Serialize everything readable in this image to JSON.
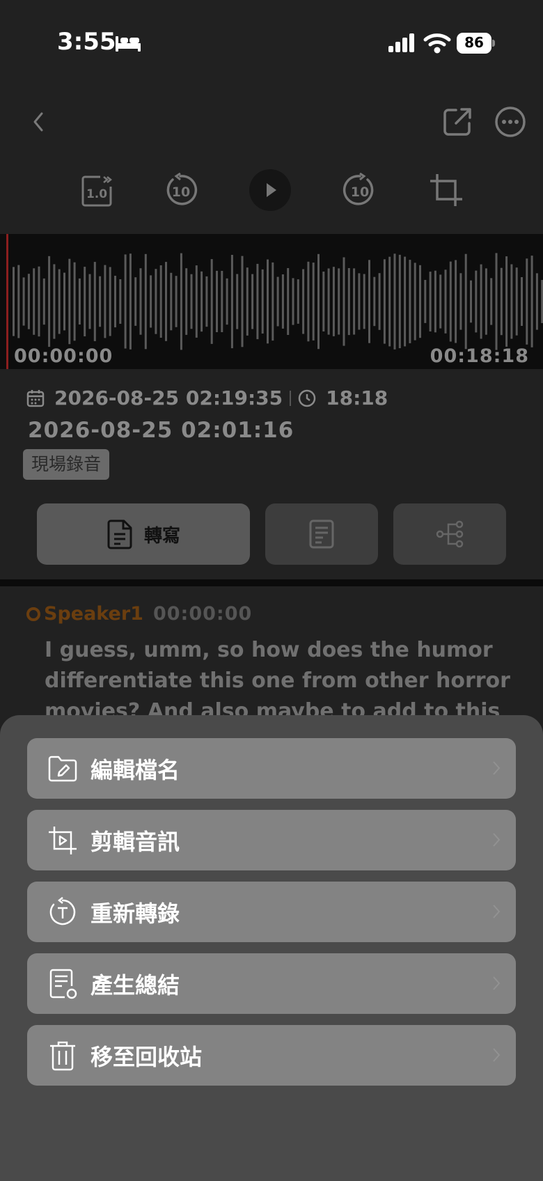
{
  "status_bar": {
    "time": "3:55",
    "battery": "86"
  },
  "player": {
    "start_time": "00:00:00",
    "end_time": "00:18:18"
  },
  "recording": {
    "datetime": "2026-08-25 02:19:35",
    "duration": "18:18",
    "title": "2026-08-25 02:01:16",
    "tag": "現場錄音"
  },
  "modes": {
    "transcribe_label": "轉寫"
  },
  "transcript": {
    "speaker": "Speaker1",
    "timestamp": "00:00:00",
    "text": "I guess, umm, so how does the humor differentiate this one from other horror movies? And also maybe to add to this"
  },
  "menu": {
    "items": [
      {
        "label": "編輯檔名",
        "icon": "folder-edit-icon"
      },
      {
        "label": "剪輯音訊",
        "icon": "crop-play-icon"
      },
      {
        "label": "重新轉錄",
        "icon": "retranscribe-icon"
      },
      {
        "label": "產生總結",
        "icon": "summary-icon"
      },
      {
        "label": "移至回收站",
        "icon": "trash-icon"
      }
    ]
  },
  "colors": {
    "background": "#212121",
    "sheet": "#4a4a4a",
    "menu_item": "#838383",
    "speaker_accent": "#6b3e0f",
    "playhead": "#8b1e1e"
  }
}
